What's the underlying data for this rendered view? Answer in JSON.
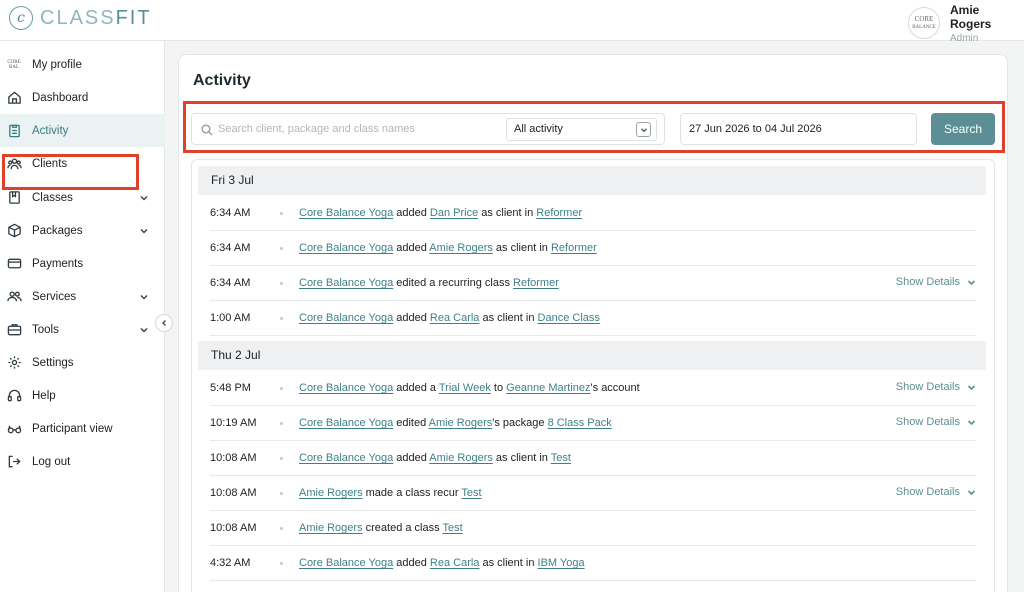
{
  "brand": {
    "mark": "c",
    "name_light": "CLASS",
    "name_bold": "FIT"
  },
  "user": {
    "name": "Amie Rogers",
    "role": "Admin",
    "logo_line1": "CORE",
    "logo_line2": "BALANCE"
  },
  "sidebar": {
    "items": [
      {
        "label": "My profile",
        "icon": "core-balance-logo-icon"
      },
      {
        "label": "Dashboard",
        "icon": "home-icon"
      },
      {
        "label": "Activity",
        "icon": "clipboard-icon",
        "active": true
      },
      {
        "label": "Clients",
        "icon": "clients-icon"
      },
      {
        "label": "Classes",
        "icon": "book-icon",
        "expandable": true
      },
      {
        "label": "Packages",
        "icon": "box-icon",
        "expandable": true
      },
      {
        "label": "Payments",
        "icon": "card-icon"
      },
      {
        "label": "Services",
        "icon": "people-icon",
        "expandable": true
      },
      {
        "label": "Tools",
        "icon": "briefcase-icon",
        "expandable": true
      },
      {
        "label": "Settings",
        "icon": "gear-icon"
      },
      {
        "label": "Help",
        "icon": "headset-icon"
      },
      {
        "label": "Participant view",
        "icon": "glasses-icon"
      },
      {
        "label": "Log out",
        "icon": "logout-icon"
      }
    ]
  },
  "main": {
    "title": "Activity",
    "filters": {
      "search_placeholder": "Search client, package and class names",
      "search_value": "",
      "activity_select": "All activity",
      "date_range": "27 Jun 2026 to 04 Jul 2026",
      "search_button": "Search"
    },
    "show_details_label": "Show Details",
    "days": [
      {
        "label": "Fri 3 Jul",
        "entries": [
          {
            "time": "6:34 AM",
            "parts": [
              {
                "text": "Core Balance Yoga",
                "link": true
              },
              {
                "text": " added "
              },
              {
                "text": "Dan Price",
                "link": true
              },
              {
                "text": " as client in "
              },
              {
                "text": "Reformer",
                "link": true
              }
            ],
            "details": false
          },
          {
            "time": "6:34 AM",
            "parts": [
              {
                "text": "Core Balance Yoga",
                "link": true
              },
              {
                "text": " added "
              },
              {
                "text": "Amie Rogers",
                "link": true
              },
              {
                "text": " as client in "
              },
              {
                "text": "Reformer",
                "link": true
              }
            ],
            "details": false
          },
          {
            "time": "6:34 AM",
            "parts": [
              {
                "text": "Core Balance Yoga",
                "link": true
              },
              {
                "text": " edited a recurring class "
              },
              {
                "text": "Reformer",
                "link": true
              }
            ],
            "details": true
          },
          {
            "time": "1:00 AM",
            "parts": [
              {
                "text": "Core Balance Yoga",
                "link": true
              },
              {
                "text": " added "
              },
              {
                "text": "Rea Carla",
                "link": true
              },
              {
                "text": " as client in "
              },
              {
                "text": "Dance Class",
                "link": true
              }
            ],
            "details": false
          }
        ]
      },
      {
        "label": "Thu 2 Jul",
        "entries": [
          {
            "time": "5:48 PM",
            "parts": [
              {
                "text": "Core Balance Yoga",
                "link": true
              },
              {
                "text": " added a "
              },
              {
                "text": "Trial Week",
                "link": true
              },
              {
                "text": " to "
              },
              {
                "text": "Geanne Martinez",
                "link": true
              },
              {
                "text": "'s account"
              }
            ],
            "details": true
          },
          {
            "time": "10:19 AM",
            "parts": [
              {
                "text": "Core Balance Yoga",
                "link": true
              },
              {
                "text": " edited "
              },
              {
                "text": "Amie Rogers",
                "link": true
              },
              {
                "text": "'s package "
              },
              {
                "text": "8 Class Pack",
                "link": true
              }
            ],
            "details": true
          },
          {
            "time": "10:08 AM",
            "parts": [
              {
                "text": "Core Balance Yoga",
                "link": true
              },
              {
                "text": " added "
              },
              {
                "text": "Amie Rogers",
                "link": true
              },
              {
                "text": " as client in "
              },
              {
                "text": "Test",
                "link": true
              }
            ],
            "details": false
          },
          {
            "time": "10:08 AM",
            "parts": [
              {
                "text": "Amie Rogers",
                "link": true
              },
              {
                "text": " made a class recur "
              },
              {
                "text": "Test",
                "link": true
              }
            ],
            "details": true
          },
          {
            "time": "10:08 AM",
            "parts": [
              {
                "text": "Amie Rogers",
                "link": true
              },
              {
                "text": " created a class "
              },
              {
                "text": "Test",
                "link": true
              }
            ],
            "details": false
          },
          {
            "time": "4:32 AM",
            "parts": [
              {
                "text": "Core Balance Yoga",
                "link": true
              },
              {
                "text": " added "
              },
              {
                "text": "Rea Carla",
                "link": true
              },
              {
                "text": " as client in "
              },
              {
                "text": "IBM Yoga",
                "link": true
              }
            ],
            "details": false
          }
        ]
      }
    ]
  }
}
